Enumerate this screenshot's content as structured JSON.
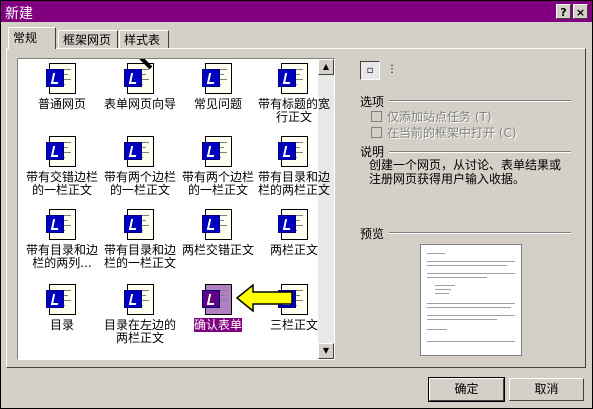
{
  "window": {
    "title": "新建",
    "help_button": "?",
    "close_button": "×"
  },
  "tabs": [
    {
      "label": "常规"
    },
    {
      "label": "框架网页"
    },
    {
      "label": "样式表"
    }
  ],
  "templates": [
    {
      "label": "普通网页"
    },
    {
      "label": "表单网页向导"
    },
    {
      "label": "常见问题"
    },
    {
      "label": "带有标题的宽行正文"
    },
    {
      "label": "带有交错边栏的一栏正文"
    },
    {
      "label": "带有两个边栏的一栏正文"
    },
    {
      "label": "带有两个边栏的一栏正文"
    },
    {
      "label": "带有目录和边栏的两栏正文"
    },
    {
      "label": "带有目录和边栏的两列..."
    },
    {
      "label": "带有目录和边栏的一栏正文"
    },
    {
      "label": "两栏交错正文"
    },
    {
      "label": "两栏正文"
    },
    {
      "label": "目录"
    },
    {
      "label": "目录在左边的两栏正文"
    },
    {
      "label": "确认表单",
      "selected": true
    },
    {
      "label": "三栏正文"
    }
  ],
  "options": {
    "heading": "选项",
    "add_task": "仅添加站点任务 (T)",
    "open_in_frame": "在当前的框架中打开 (C)"
  },
  "description": {
    "heading": "说明",
    "text": "创建一个网页，从讨论、表单结果或注册网页获得用户输入收据。"
  },
  "preview": {
    "heading": "预览"
  },
  "buttons": {
    "ok": "确定",
    "cancel": "取消"
  },
  "colors": {
    "title_bar": "#800080",
    "selection": "#800080",
    "arrow": "#ffff00"
  }
}
